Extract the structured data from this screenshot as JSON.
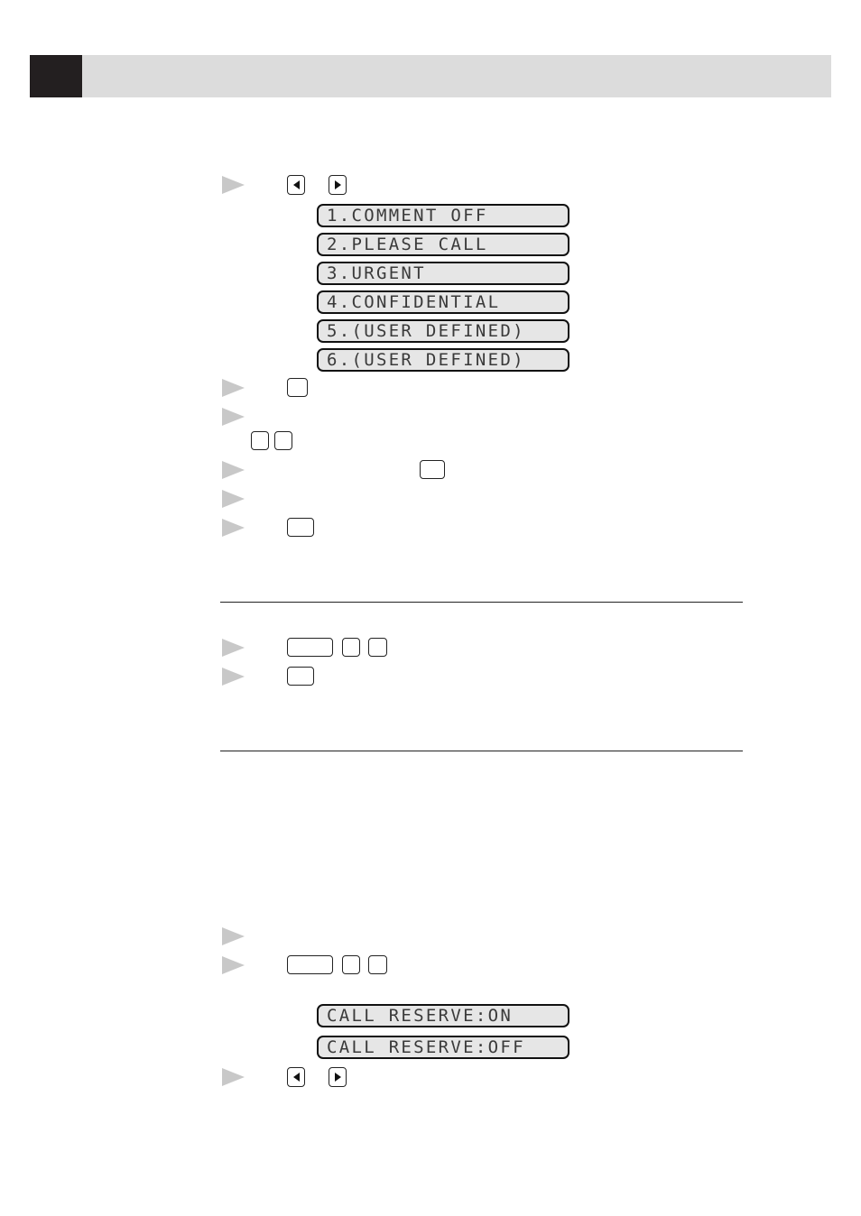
{
  "header": {
    "bar_color": "#dcdcdc",
    "tab_color": "#231f20"
  },
  "section1": {
    "arrow_keys": [
      "left-arrow",
      "right-arrow"
    ],
    "lcd_options": [
      "1.COMMENT OFF",
      "2.PLEASE CALL",
      "3.URGENT",
      "4.CONFIDENTIAL",
      "5.(USER DEFINED)",
      "6.(USER DEFINED)"
    ]
  },
  "section3": {
    "lcd_options": [
      "CALL RESERVE:ON",
      "CALL RESERVE:OFF"
    ],
    "arrow_keys": [
      "left-arrow",
      "right-arrow"
    ]
  },
  "colors": {
    "bullet": "#c8c8c8",
    "lcd_background": "#e6e6e6",
    "rule": "#222222"
  }
}
